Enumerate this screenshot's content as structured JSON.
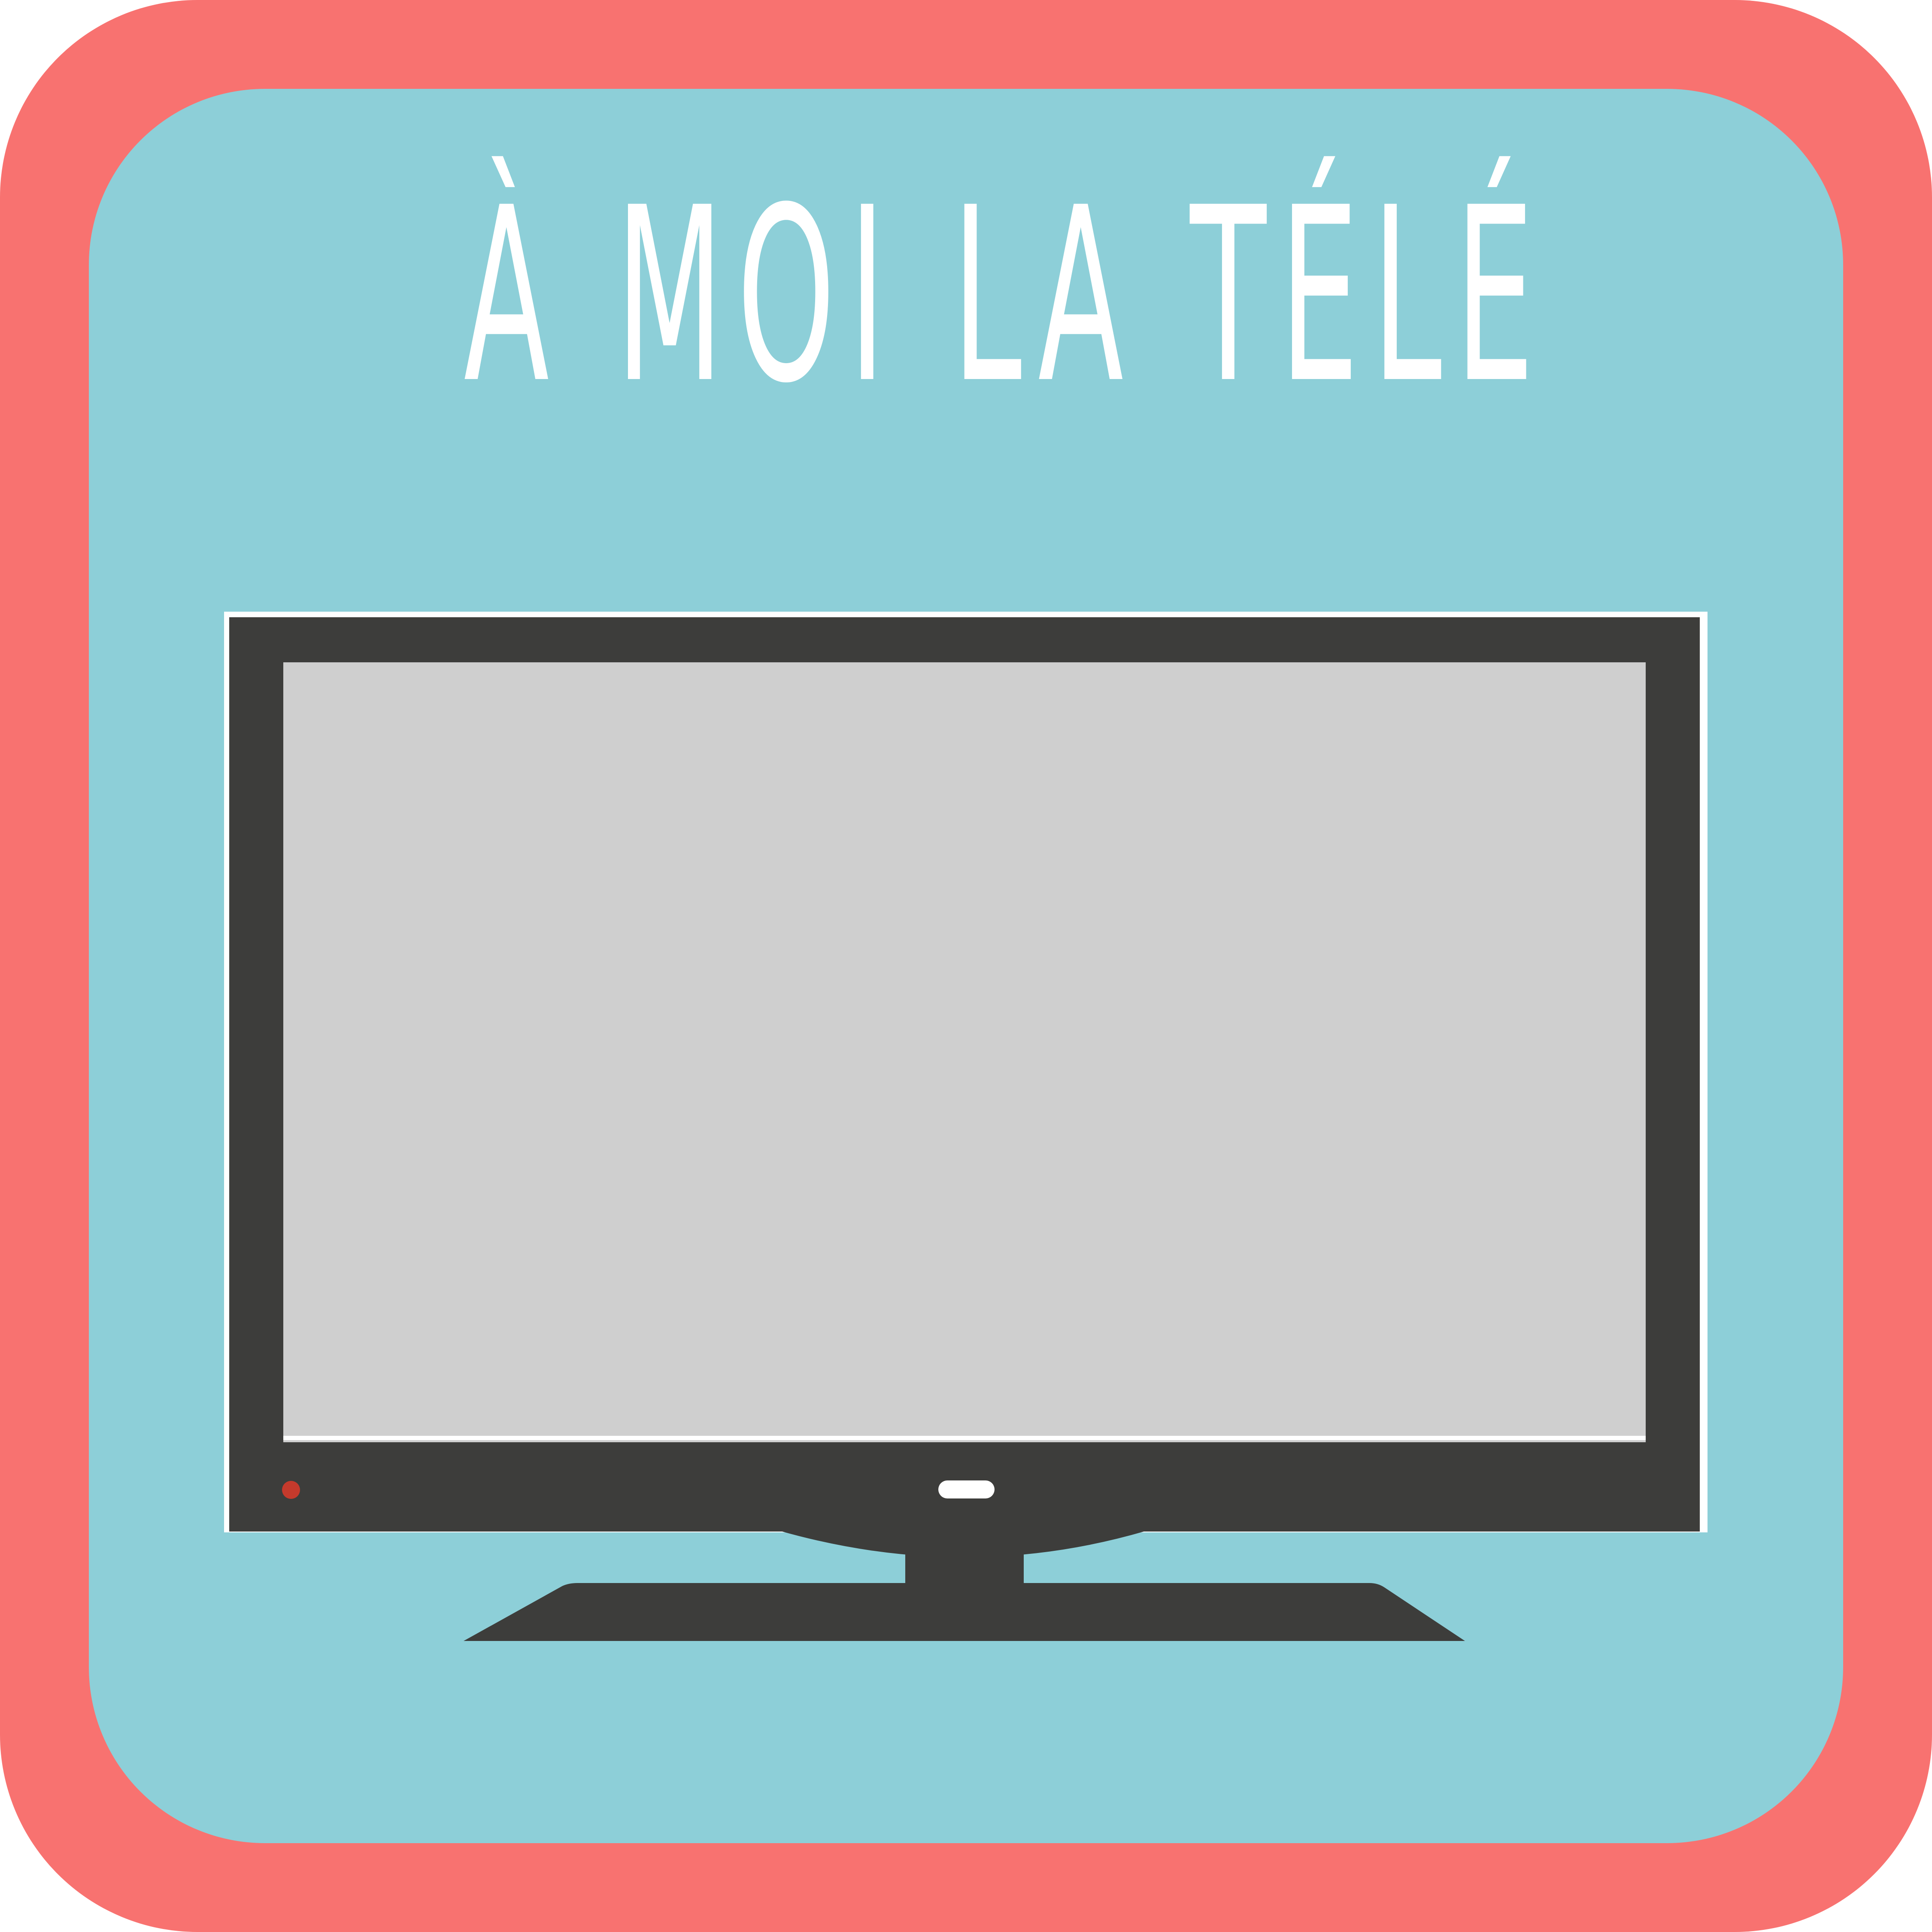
{
  "title": "À MOI LA TÉLÉ",
  "colors": {
    "frame": "#f87270",
    "panel": "#8dcfd8",
    "bezel": "#3d3d3b",
    "screen": "#cfcfcf",
    "power_light": "#c53a2c",
    "outline": "#ffffff"
  },
  "icons": {
    "television": "television-icon",
    "power_light": "power-light-icon",
    "logo_button": "tv-logo-bar-icon"
  }
}
